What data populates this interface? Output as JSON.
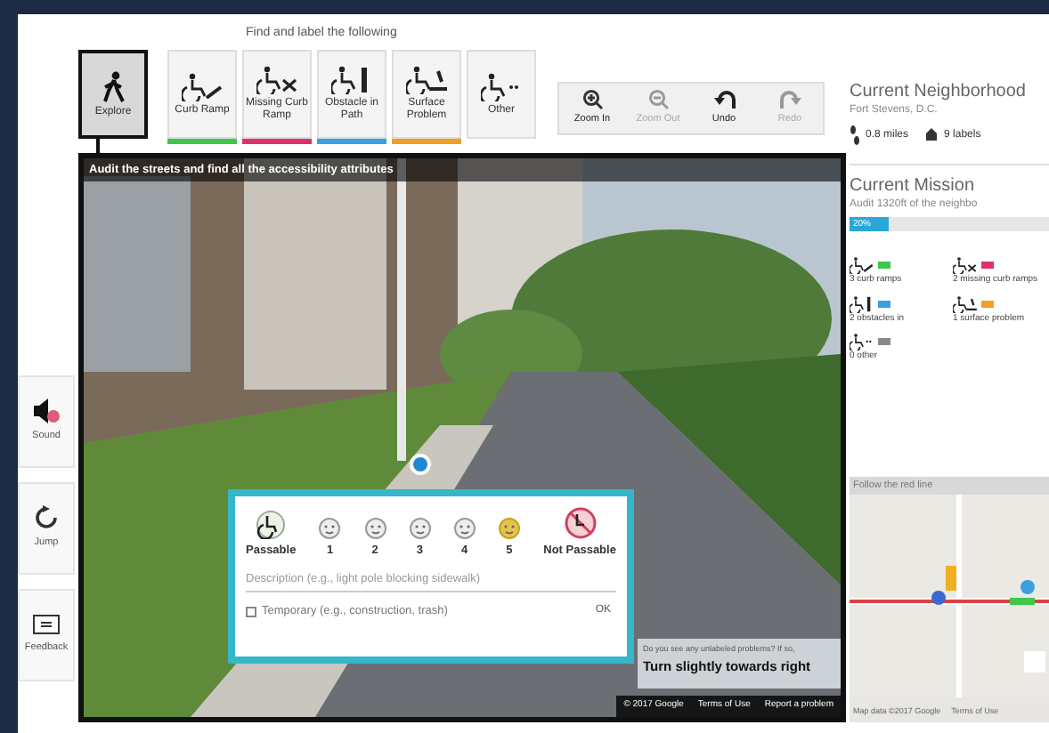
{
  "toolbar": {
    "heading": "Find and label the following",
    "modes": [
      {
        "label": "Explore",
        "kind": "explore",
        "selected": true
      },
      {
        "label": "Curb Ramp",
        "kind": "curb",
        "selected": false,
        "color": "#3ec74a"
      },
      {
        "label": "Missing Curb Ramp",
        "kind": "missing",
        "selected": false,
        "color": "#e0306a"
      },
      {
        "label": "Obstacle in Path",
        "kind": "obstacle",
        "selected": false,
        "color": "#3aa0e0"
      },
      {
        "label": "Surface Problem",
        "kind": "surface",
        "selected": false,
        "color": "#f0a020"
      },
      {
        "label": "Other",
        "kind": "other",
        "selected": false
      }
    ],
    "actions": [
      {
        "label": "Zoom In",
        "kind": "zoomin",
        "disabled": false
      },
      {
        "label": "Zoom Out",
        "kind": "zoomout",
        "disabled": true
      },
      {
        "label": "Undo",
        "kind": "undo",
        "disabled": false
      },
      {
        "label": "Redo",
        "kind": "redo",
        "disabled": true
      }
    ]
  },
  "side_buttons": [
    {
      "label": "Sound",
      "kind": "sound"
    },
    {
      "label": "Jump",
      "kind": "jump"
    },
    {
      "label": "Feedback",
      "kind": "feedback"
    }
  ],
  "street_view": {
    "instruction": "Audit the streets and find all the accessibility attributes",
    "hint": "Do you see any unlabeled problems? If so,",
    "direction": "Turn slightly towards right",
    "footer": [
      "© 2017 Google",
      "Terms of Use",
      "Report a problem"
    ]
  },
  "label_popup": {
    "ratings": [
      {
        "label": "Passable",
        "kind": "passable",
        "selected": false
      },
      {
        "label": "1",
        "kind": "face",
        "selected": false
      },
      {
        "label": "2",
        "kind": "face",
        "selected": false
      },
      {
        "label": "3",
        "kind": "face",
        "selected": false
      },
      {
        "label": "4",
        "kind": "face",
        "selected": false
      },
      {
        "label": "5",
        "kind": "face",
        "selected": true
      },
      {
        "label": "Not Passable",
        "kind": "notpassable",
        "selected": false
      }
    ],
    "description": {
      "placeholder": "Description (e.g., light pole blocking sidewalk)"
    },
    "temporary": {
      "label": "Temporary (e.g., construction, trash)",
      "checked": false
    },
    "ok": "OK"
  },
  "neighborhood": {
    "title": "Current Neighborhood",
    "name": "Fort Stevens, D.C.",
    "distance": "0.8 miles",
    "labels": "9 labels"
  },
  "mission": {
    "title": "Current Mission",
    "text": "Audit 1320ft of the neighbo",
    "level": 0.2,
    "badge": "20%",
    "stats": [
      {
        "label": "3 curb ramps",
        "color": "#3ec74a",
        "kind": "curb"
      },
      {
        "label": "2 missing curb ramps",
        "color": "#e0306a",
        "kind": "missing"
      },
      {
        "label": "2 obstacles in",
        "color": "#3aa0e0",
        "kind": "obstacle"
      },
      {
        "label": "1 surface problem",
        "color": "#f0a020",
        "kind": "surface"
      },
      {
        "label": "0 other",
        "color": "#888888",
        "kind": "other"
      }
    ]
  },
  "map": {
    "heading": "Follow the red line",
    "footer": [
      "Map data ©2017 Google",
      "Terms of Use"
    ]
  }
}
